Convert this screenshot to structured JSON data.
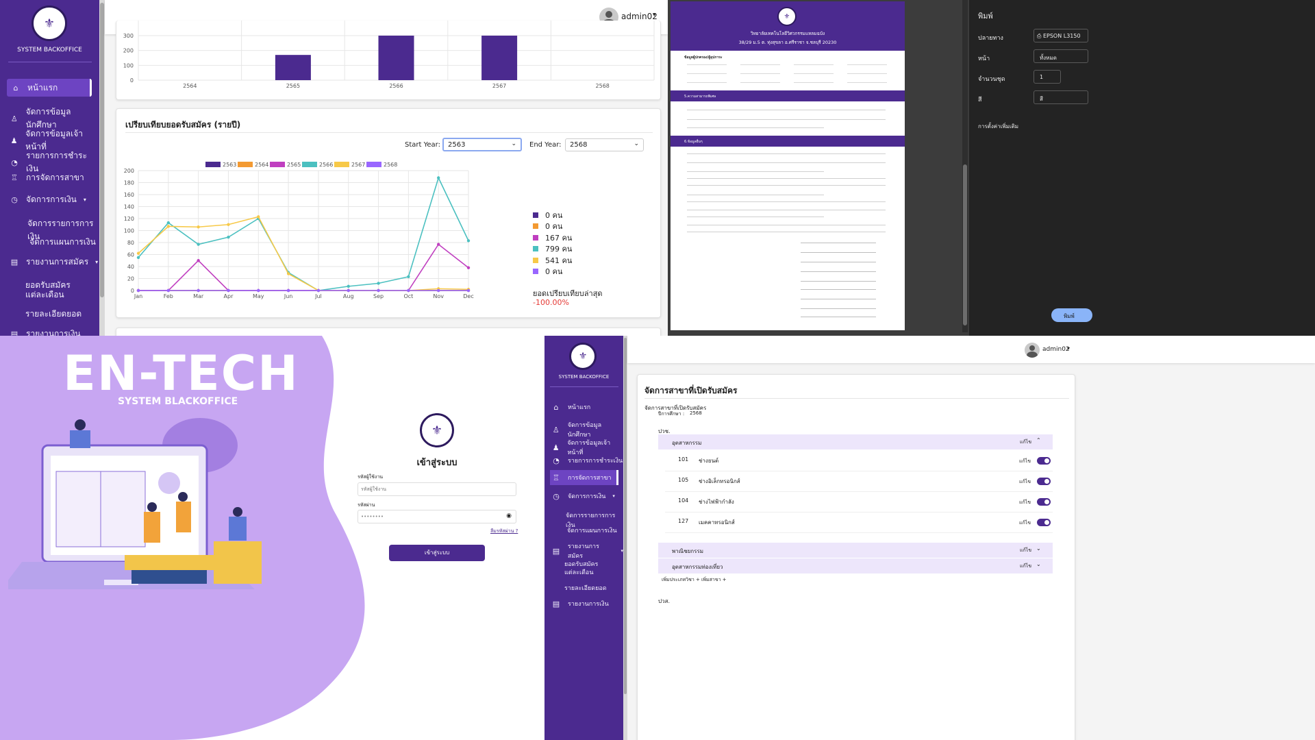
{
  "sidebar": {
    "brand": "SYSTEM BACKOFFICE",
    "items": [
      {
        "label": "หน้าแรก",
        "icon": "home-icon"
      },
      {
        "label": "จัดการข้อมูลนักศึกษา",
        "icon": "student-icon"
      },
      {
        "label": "จัดการข้อมูลเจ้าหน้าที่",
        "icon": "user-icon"
      },
      {
        "label": "รายการการชำระเงิน",
        "icon": "payment-icon"
      },
      {
        "label": "การจัดการสาขา",
        "icon": "branch-icon"
      },
      {
        "label": "จัดการการเงิน",
        "icon": "finance-icon"
      },
      {
        "label": "จัดการรายการการเงิน"
      },
      {
        "label": "จัดการแผนการเงิน"
      },
      {
        "label": "รายงานการสมัคร",
        "icon": "report-icon"
      },
      {
        "label": "ยอดรับสมัครแต่ละเดือน"
      },
      {
        "label": "รายละเอียดยอด"
      },
      {
        "label": "รายงานการเงิน",
        "icon": "report-icon"
      }
    ]
  },
  "header": {
    "username": "admin02"
  },
  "bar_chart": {
    "type": "bar",
    "categories": [
      "2564",
      "2565",
      "2566",
      "2567",
      "2568"
    ],
    "values": [
      0,
      170,
      300,
      300,
      0
    ],
    "yticks": [
      "300",
      "200",
      "100",
      "0"
    ],
    "ylim": [
      0,
      300
    ]
  },
  "compare_card": {
    "title": "เปรียบเทียบยอดรับสมัคร (รายปี)",
    "start_label": "Start Year:",
    "start_value": "2563",
    "end_label": "End Year:",
    "end_value": "2568",
    "summary_label": "ยอดเปรียบเทียบล่าสุด",
    "summary_value": "-100.00%",
    "legend_counts": [
      {
        "text": "0 คน",
        "color": "#4b2a8f"
      },
      {
        "text": "0 คน",
        "color": "#f39a32"
      },
      {
        "text": "167 คน",
        "color": "#c03fc0"
      },
      {
        "text": "799 คน",
        "color": "#4bc0c0"
      },
      {
        "text": "541 คน",
        "color": "#f7c948"
      },
      {
        "text": "0 คน",
        "color": "#9966ff"
      }
    ]
  },
  "chart_data": {
    "type": "line",
    "x": [
      "Jan",
      "Feb",
      "Mar",
      "Apr",
      "May",
      "Jun",
      "Jul",
      "Aug",
      "Sep",
      "Oct",
      "Nov",
      "Dec"
    ],
    "ylim": [
      0,
      200
    ],
    "yticks": [
      0,
      20,
      40,
      60,
      80,
      100,
      120,
      140,
      160,
      180,
      200
    ],
    "series": [
      {
        "name": "2563",
        "color": "#4b2a8f",
        "values": [
          0,
          0,
          0,
          0,
          0,
          0,
          0,
          0,
          0,
          0,
          0,
          0
        ]
      },
      {
        "name": "2564",
        "color": "#f39a32",
        "values": [
          0,
          0,
          0,
          0,
          0,
          0,
          0,
          0,
          0,
          0,
          0,
          0
        ]
      },
      {
        "name": "2565",
        "color": "#c03fc0",
        "values": [
          0,
          0,
          50,
          0,
          0,
          0,
          0,
          0,
          0,
          0,
          77,
          38
        ]
      },
      {
        "name": "2566",
        "color": "#4bc0c0",
        "values": [
          55,
          113,
          77,
          89,
          120,
          30,
          0,
          7,
          12,
          23,
          188,
          83
        ]
      },
      {
        "name": "2567",
        "color": "#f7c948",
        "values": [
          62,
          107,
          106,
          110,
          123,
          28,
          0,
          0,
          0,
          0,
          3,
          2
        ]
      },
      {
        "name": "2568",
        "color": "#9966ff",
        "values": [
          0,
          0,
          0,
          0,
          0,
          0,
          0,
          0,
          0,
          0,
          0,
          0
        ]
      }
    ]
  },
  "print_doc": {
    "org_line1": "วิทยาลัยเทคโนโลยีวิศวกรรมแหลมฉบัง",
    "org_line2": "38/29 ม.5 ต. ทุ่งสุขลา อ.ศรีราชา จ.ชลบุรี 20230",
    "section1": "ข้อมูลผู้ปกครอง/ผู้อุปการะ",
    "section2": "5.ความสามารถพิเศษ",
    "section3": "6.ข้อมูลอื่นๆ"
  },
  "print_panel": {
    "title": "พิมพ์",
    "dest_label": "ปลายทาง",
    "dest_value": "EPSON L3150",
    "pages_label": "หน้า",
    "pages_value": "ทั้งหมด",
    "copies_label": "จำนวนชุด",
    "copies_value": "1",
    "color_label": "สี",
    "color_value": "สี",
    "more_label": "การตั้งค่าเพิ่มเติม",
    "print_button": "พิมพ์"
  },
  "login": {
    "brand": "EN-TECH",
    "subtitle": "SYSTEM BLACKOFFICE",
    "heading": "เข้าสู่ระบบ",
    "user_label": "รหัสผู้ใช้งาน",
    "user_placeholder": "รหัสผู้ใช้งาน",
    "pass_label": "รหัสผ่าน",
    "pass_value": "••••••••",
    "forgot": "ลืมรหัสผ่าน ?",
    "submit": "เข้าสู่ระบบ"
  },
  "branch": {
    "title": "จัดการสาขาที่เปิดรับสมัคร",
    "subtitle": "จัดการสาขาที่เปิดรับสมัคร",
    "year_label": "ปีการศึกษา :",
    "year_value": "2568",
    "level": "ปวช.",
    "groups": [
      {
        "name": "อุตสาหกรรม",
        "edit": "แก้ไข"
      },
      {
        "name": "พาณิชยกรรม",
        "edit": "แก้ไข"
      },
      {
        "name": "อุตสาหกรรมท่องเที่ยว",
        "edit": "แก้ไข"
      }
    ],
    "rows": [
      {
        "code": "101",
        "name": "ช่างยนต์",
        "edit": "แก้ไข"
      },
      {
        "code": "105",
        "name": "ช่างอิเล็กทรอนิกส์",
        "edit": "แก้ไข"
      },
      {
        "code": "104",
        "name": "ช่างไฟฟ้ากำลัง",
        "edit": "แก้ไข"
      },
      {
        "code": "127",
        "name": "เมคคาทรอนิกส์",
        "edit": "แก้ไข"
      }
    ],
    "add_type": "เพิ่มประเภทวิชา +",
    "add_branch": "เพิ่มสาขา +",
    "level2": "ปวส."
  }
}
